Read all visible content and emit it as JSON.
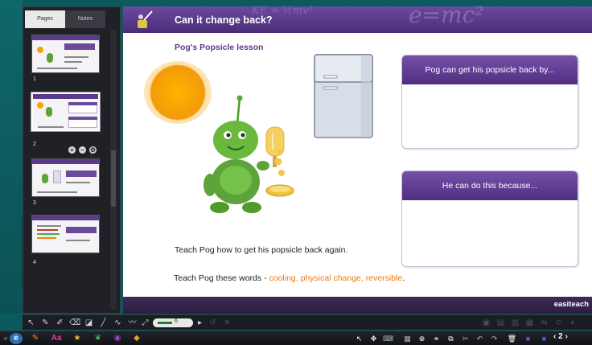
{
  "panel": {
    "tabs": [
      {
        "label": "Pages",
        "active": true
      },
      {
        "label": "Notes",
        "active": false
      }
    ],
    "thumbnails": [
      {
        "number": "1"
      },
      {
        "number": "2",
        "selected": true
      },
      {
        "number": "3"
      },
      {
        "number": "4"
      }
    ],
    "thumb_tools": [
      "+",
      "−",
      "⚙"
    ]
  },
  "slide": {
    "header_title": "Can it change back?",
    "header_deco_formula": "KE = ½mv²",
    "header_deco_emc": "e=mc²",
    "lesson_title": "Pog's Popsicle lesson",
    "box1_title": "Pog can get his popsicle back by...",
    "box2_title": "He can do this because...",
    "teach_line1": "Teach Pog how to get his popsicle back again.",
    "teach_line2_prefix": "Teach Pog these words - ",
    "teach_line2_words": "cooling, physical change, reversible",
    "teach_line2_suffix": ".",
    "brand": "easiteach",
    "colors": {
      "header": "#5b3a8a",
      "accent_words": "#f07a10"
    }
  },
  "toolbar": {
    "pen_width_value": "6",
    "tools": [
      "select-tool",
      "pen-tool",
      "highlighter-tool",
      "eraser-tool",
      "shape-tool",
      "line-tool",
      "curve-tool",
      "freehand-tool"
    ]
  },
  "taskbar": {
    "page_number": "2",
    "apps": [
      "easiteach-app",
      "pen-app",
      "text-app",
      "star-app",
      "leaf-app",
      "media-app",
      "shape-app"
    ]
  }
}
